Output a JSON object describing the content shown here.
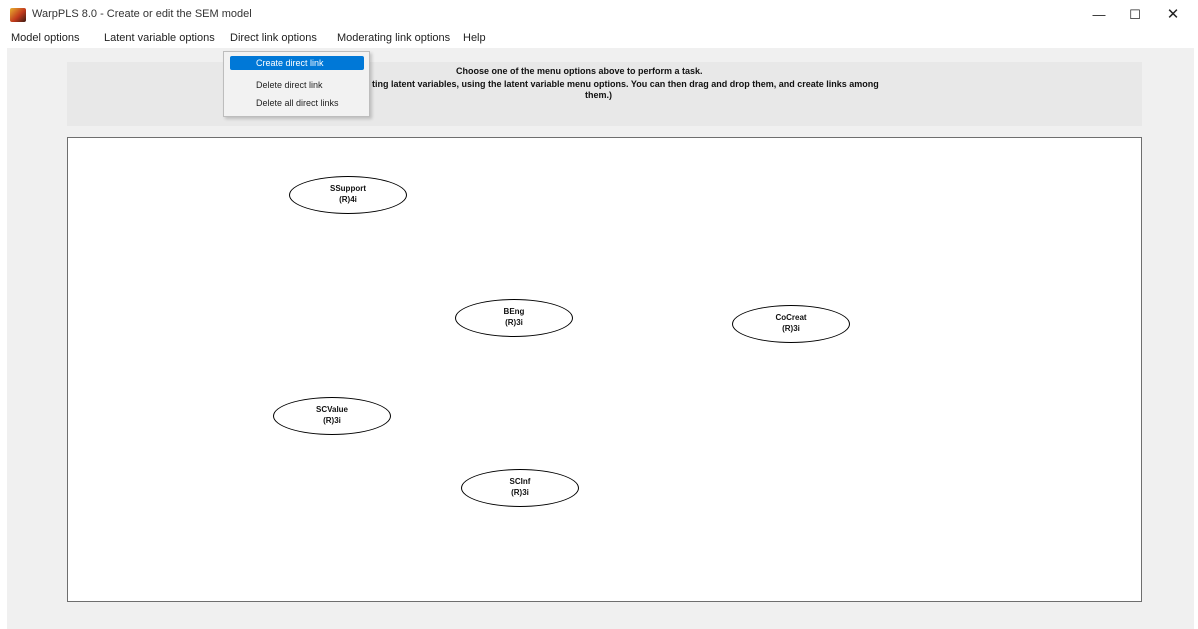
{
  "window": {
    "title": "WarpPLS 8.0 - Create or edit the SEM model",
    "minimize_glyph": "—",
    "maximize_glyph": "☐",
    "close_glyph": "✕"
  },
  "menubar": {
    "items": [
      {
        "label": "Model options"
      },
      {
        "label": "Latent variable options"
      },
      {
        "label": "Direct link options"
      },
      {
        "label": "Moderating link options"
      },
      {
        "label": "Help"
      }
    ]
  },
  "dropdown": {
    "items": [
      {
        "label": "Create direct link",
        "selected": true
      },
      {
        "label": "Delete direct link",
        "selected": false
      },
      {
        "label": "Delete all direct links",
        "selected": false
      }
    ]
  },
  "info": {
    "line1": "Choose one of the menu options above to perform a task.",
    "line2": "ting latent variables, using the latent variable menu options. You can then drag and drop them, and create links among",
    "line3": "them.)"
  },
  "latent_variables": [
    {
      "name": "SSupport",
      "info": "(R)4i"
    },
    {
      "name": "BEng",
      "info": "(R)3i"
    },
    {
      "name": "CoCreat",
      "info": "(R)3i"
    },
    {
      "name": "SCValue",
      "info": "(R)3i"
    },
    {
      "name": "SCInf",
      "info": "(R)3i"
    }
  ],
  "colors": {
    "selection": "#0078d7",
    "client_background": "#f0f0f0",
    "info_panel": "#e8e8e8",
    "canvas": "#ffffff"
  }
}
